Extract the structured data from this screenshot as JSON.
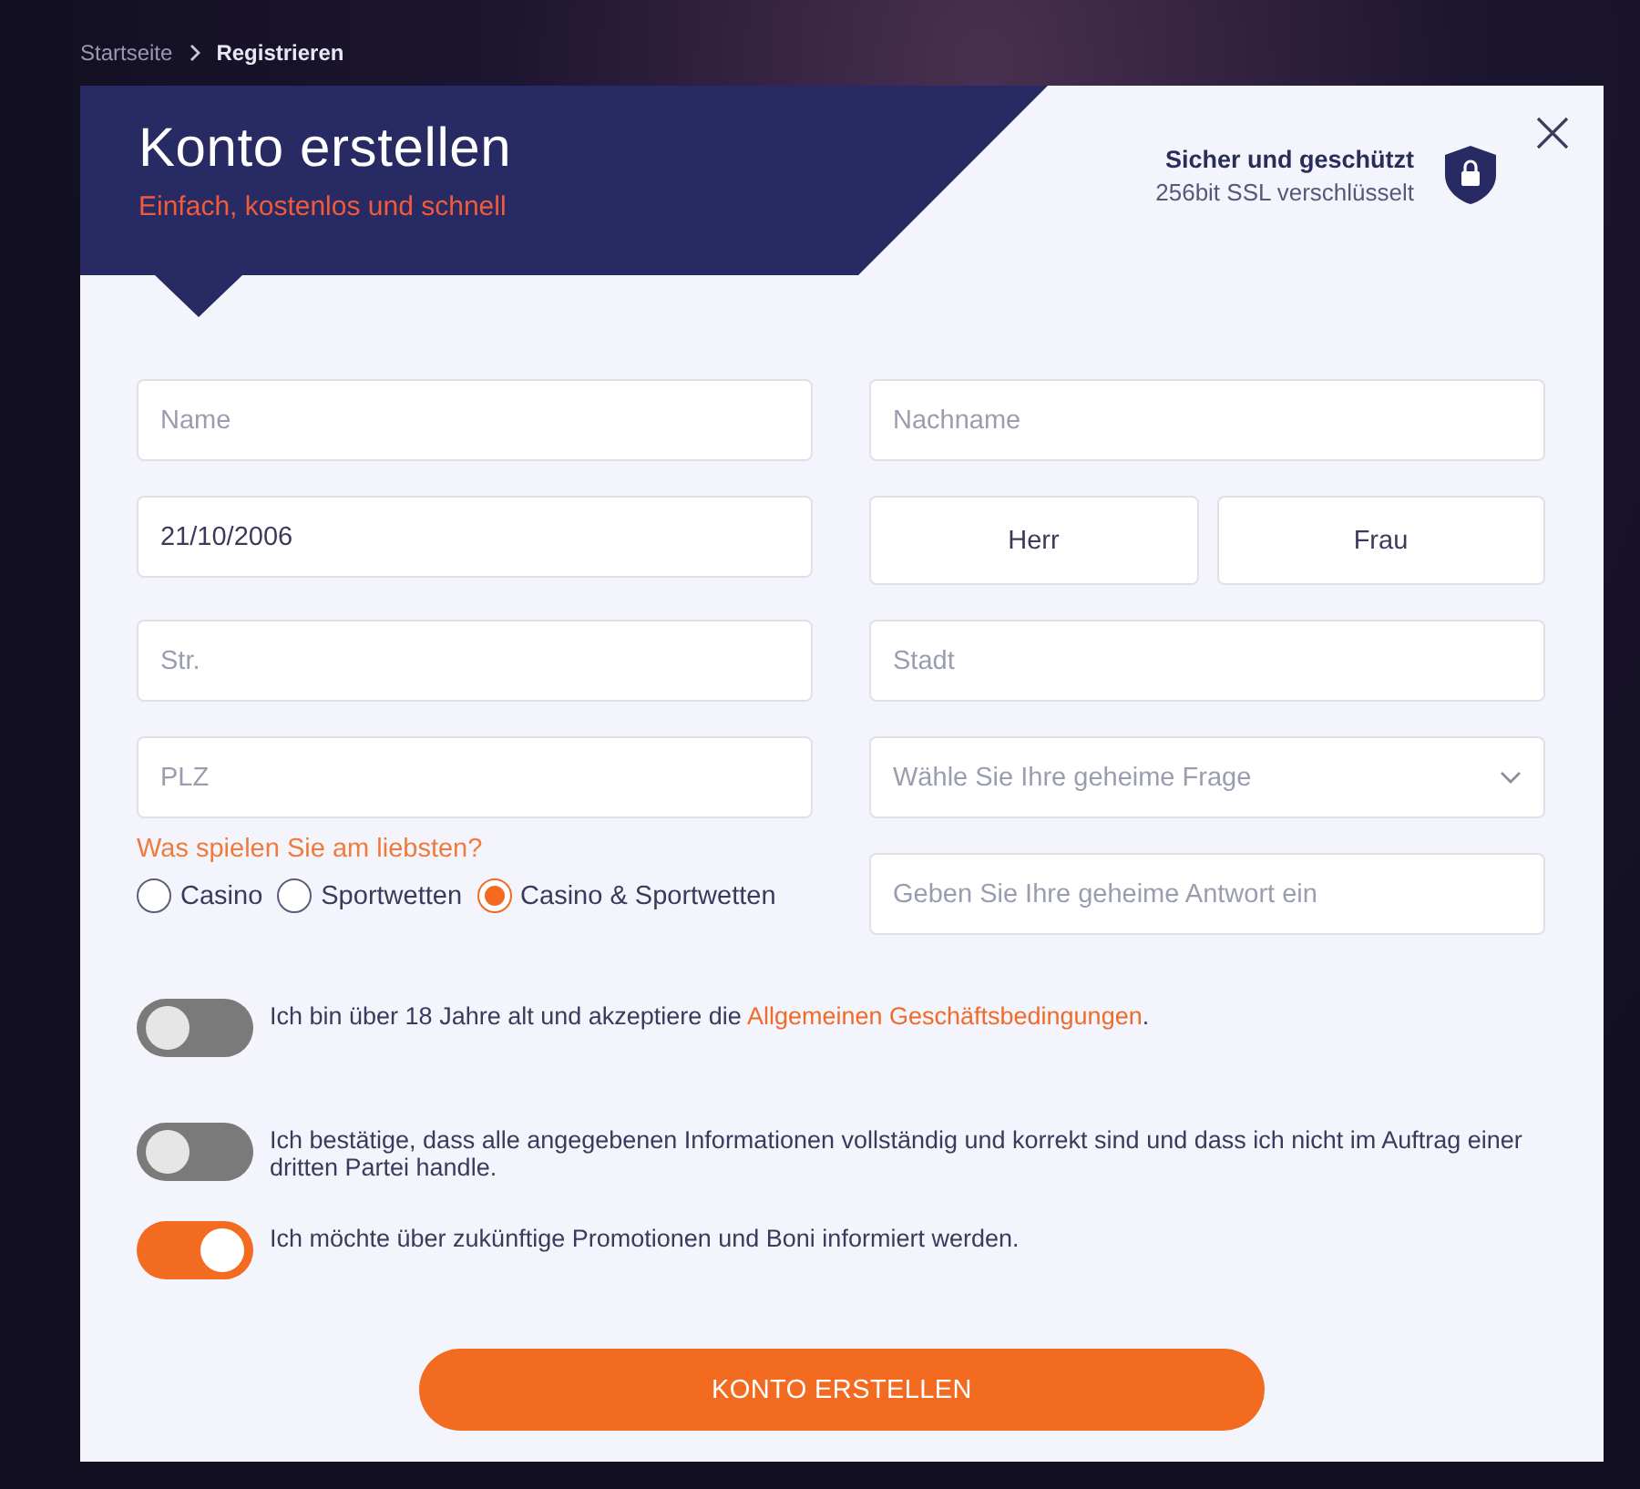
{
  "breadcrumb": [
    {
      "label": "Startseite",
      "selected": false
    },
    {
      "label": "Registrieren",
      "selected": true
    }
  ],
  "header": {
    "title": "Konto erstellen",
    "subtitle": "Einfach, kostenlos und schnell"
  },
  "security": {
    "title": "Sicher und geschützt",
    "subtitle": "256bit SSL verschlüsselt"
  },
  "fields": [
    {
      "kind": "input",
      "placeholder": "Name"
    },
    {
      "kind": "input",
      "placeholder": "Nachname"
    },
    {
      "kind": "input",
      "value": "21/10/2006"
    },
    {
      "kind": "gender",
      "options": [
        {
          "label": "Herr",
          "selected": false
        },
        {
          "label": "Frau",
          "selected": false
        }
      ]
    },
    {
      "kind": "input",
      "placeholder": "Str."
    },
    {
      "kind": "input",
      "placeholder": "Stadt"
    },
    {
      "kind": "input",
      "placeholder": "PLZ"
    },
    {
      "kind": "select",
      "placeholder": "Wähle Sie Ihre geheime Frage"
    },
    {
      "kind": "radio",
      "label": "Was spielen Sie am liebsten?",
      "options": [
        {
          "label": "Casino",
          "selected": false
        },
        {
          "label": "Sportwetten",
          "selected": false
        },
        {
          "label": "Casino & Sportwetten",
          "selected": true
        }
      ]
    },
    {
      "kind": "input",
      "placeholder": "Geben Sie Ihre geheime Antwort ein"
    }
  ],
  "consents": [
    {
      "on": false,
      "text": "Ich bin über 18 Jahre alt und akzeptiere die ",
      "link": "Allgemeinen Geschäftsbedingungen",
      "after": "."
    },
    {
      "on": false,
      "text": "Ich bestätige, dass alle angegebenen Informationen vollständig und korrekt sind und dass ich nicht im Auftrag einer dritten Partei handle."
    },
    {
      "on": true,
      "text": "Ich möchte über zukünftige Promotionen und Boni informiert werden."
    }
  ],
  "submit": "KONTO ERSTELLEN"
}
